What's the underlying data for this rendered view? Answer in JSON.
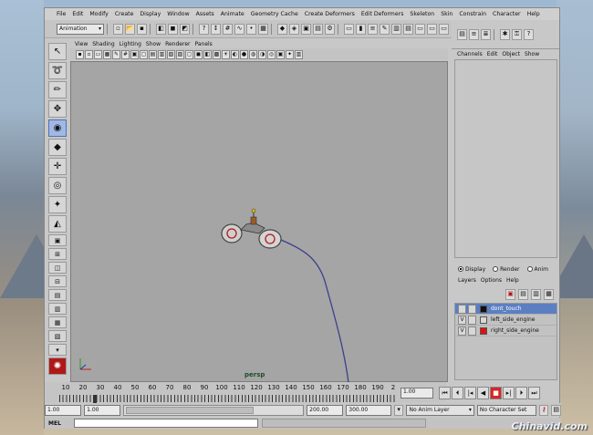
{
  "menubar": [
    "File",
    "Edit",
    "Modify",
    "Create",
    "Display",
    "Window",
    "Assets",
    "Animate",
    "Geometry Cache",
    "Create Deformers",
    "Edit Deformers",
    "Skeleton",
    "Skin",
    "Constrain",
    "Character",
    "Help"
  ],
  "statusline": {
    "mode": "Animation"
  },
  "panel_menu": [
    "View",
    "Shading",
    "Lighting",
    "Show",
    "Renderer",
    "Panels"
  ],
  "viewport": {
    "camera": "persp"
  },
  "channel_box": {
    "menu": [
      "Channels",
      "Edit",
      "Object",
      "Show"
    ]
  },
  "layer_editor": {
    "radio": [
      {
        "label": "Display",
        "selected": true
      },
      {
        "label": "Render",
        "selected": false
      },
      {
        "label": "Anim",
        "selected": false
      }
    ],
    "menu": [
      "Layers",
      "Options",
      "Help"
    ],
    "layers": [
      {
        "visible": "",
        "name": "dont_touch",
        "color": "#111111",
        "selected": true
      },
      {
        "visible": "V",
        "name": "left_side_engine",
        "color": "#d8d8d8",
        "selected": false
      },
      {
        "visible": "V",
        "name": "right_side_engine",
        "color": "#e01010",
        "selected": false
      }
    ]
  },
  "time_slider": {
    "ticks": [
      "10",
      "20",
      "30",
      "40",
      "50",
      "60",
      "70",
      "80",
      "90",
      "100",
      "110",
      "120",
      "130",
      "140",
      "150",
      "160",
      "170",
      "180",
      "190",
      "2"
    ],
    "current_frame": "1.00"
  },
  "range_slider": {
    "start": "1.00",
    "inner_start": "1.00",
    "inner_end": "200.00",
    "end": "300.00",
    "anim_layer": "No Anim Layer",
    "character_set": "No Character Set"
  },
  "command_line": {
    "label": "MEL"
  },
  "watermark": "Chinavid.com"
}
